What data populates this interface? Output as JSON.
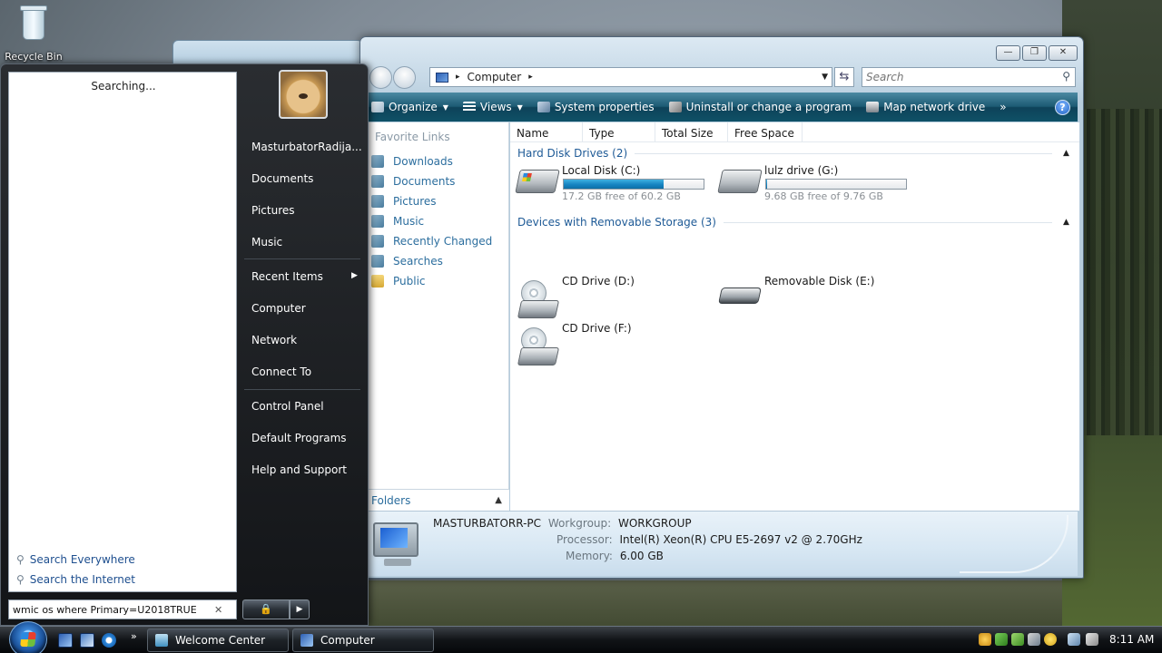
{
  "desktop": {
    "recycle_bin_label": "Recycle Bin"
  },
  "explorer": {
    "window_controls": {
      "minimize": "—",
      "maximize": "❐",
      "close": "✕"
    },
    "address": {
      "location": "Computer"
    },
    "search": {
      "placeholder": "Search"
    },
    "toolbar": {
      "organize": "Organize",
      "views": "Views",
      "system_properties": "System properties",
      "uninstall": "Uninstall or change a program",
      "map_drive": "Map network drive",
      "more": "»",
      "help": "?"
    },
    "nav_pane": {
      "title": "Favorite Links",
      "links": [
        "Downloads",
        "Documents",
        "Pictures",
        "Music",
        "Recently Changed",
        "Searches",
        "Public"
      ],
      "folders_label": "Folders"
    },
    "columns": [
      "Name",
      "Type",
      "Total Size",
      "Free Space"
    ],
    "groups": [
      {
        "title": "Hard Disk Drives (2)"
      },
      {
        "title": "Devices with Removable Storage (3)"
      }
    ],
    "hard_drives": [
      {
        "name": "Local Disk (C:)",
        "free_text": "17.2 GB free of 60.2 GB",
        "used_fraction": 0.714
      },
      {
        "name": "lulz drive (G:)",
        "free_text": "9.68 GB free of 9.76 GB",
        "used_fraction": 0.008
      }
    ],
    "removable": [
      {
        "name": "CD Drive (D:)"
      },
      {
        "name": "Removable Disk (E:)"
      },
      {
        "name": "CD Drive (F:)"
      }
    ],
    "details": {
      "pc_name": "MASTURBATORR-PC",
      "workgroup_label": "Workgroup:",
      "workgroup": "WORKGROUP",
      "processor_label": "Processor:",
      "processor": "Intel(R) Xeon(R) CPU E5-2697 v2 @ 2.70GHz",
      "memory_label": "Memory:",
      "memory": "6.00 GB"
    }
  },
  "start_menu": {
    "status": "Searching...",
    "search_everywhere": "Search Everywhere",
    "search_internet": "Search the Internet",
    "search_query": "wmic os where Primary=U2018TRUE",
    "right_items": {
      "user": "MasturbatorRadija...",
      "documents": "Documents",
      "pictures": "Pictures",
      "music": "Music",
      "recent": "Recent Items",
      "computer": "Computer",
      "network": "Network",
      "connect": "Connect To",
      "control_panel": "Control Panel",
      "default_programs": "Default Programs",
      "help": "Help and Support"
    }
  },
  "taskbar": {
    "quicklaunch_more": "»",
    "buttons": [
      "Welcome Center",
      "Computer"
    ],
    "clock": "8:11 AM"
  }
}
